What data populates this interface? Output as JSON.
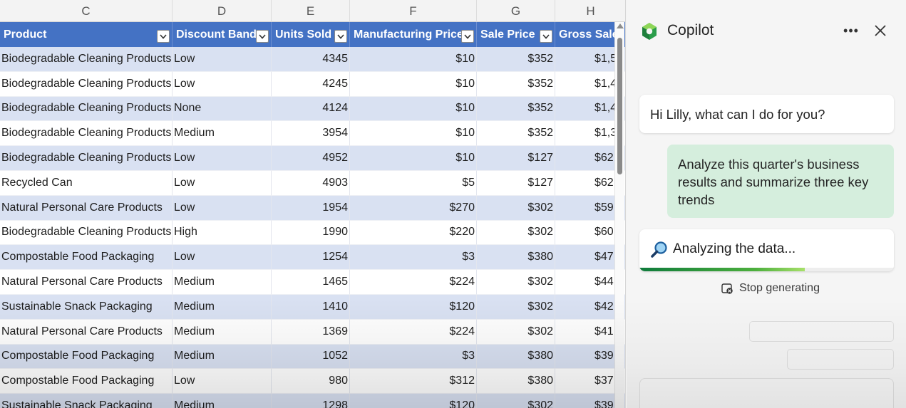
{
  "sheet": {
    "column_letters": [
      "C",
      "D",
      "E",
      "F",
      "G",
      "H"
    ],
    "headers": [
      "Product",
      "Discount Band",
      "Units Sold",
      "Manufacturing Price",
      "Sale Price",
      "Gross Sales"
    ],
    "rows": [
      [
        "Biodegradable Cleaning Products",
        "Low",
        "4345",
        "$10",
        "$352",
        "$1,5"
      ],
      [
        "Biodegradable Cleaning Products",
        "Low",
        "4245",
        "$10",
        "$352",
        "$1,4"
      ],
      [
        "Biodegradable Cleaning Products",
        "None",
        "4124",
        "$10",
        "$352",
        "$1,4"
      ],
      [
        "Biodegradable Cleaning Products",
        "Medium",
        "3954",
        "$10",
        "$352",
        "$1,3"
      ],
      [
        "Biodegradable Cleaning Products",
        "Low",
        "4952",
        "$10",
        "$127",
        "$62"
      ],
      [
        "Recycled Can",
        "Low",
        "4903",
        "$5",
        "$127",
        "$62"
      ],
      [
        "Natural Personal Care Products",
        "Low",
        "1954",
        "$270",
        "$302",
        "$59"
      ],
      [
        "Biodegradable Cleaning Products",
        "High",
        "1990",
        "$220",
        "$302",
        "$60"
      ],
      [
        "Compostable Food Packaging",
        "Low",
        "1254",
        "$3",
        "$380",
        "$47"
      ],
      [
        "Natural Personal Care Products",
        "Medium",
        "1465",
        "$224",
        "$302",
        "$44"
      ],
      [
        "Sustainable Snack Packaging",
        "Medium",
        "1410",
        "$120",
        "$302",
        "$42"
      ],
      [
        "Natural Personal Care Products",
        "Medium",
        "1369",
        "$224",
        "$302",
        "$41"
      ],
      [
        "Compostable Food Packaging",
        "Medium",
        "1052",
        "$3",
        "$380",
        "$39"
      ],
      [
        "Compostable Food Packaging",
        "Low",
        "980",
        "$312",
        "$380",
        "$37"
      ],
      [
        "Sustainable Snack Packaging",
        "Medium",
        "1298",
        "$120",
        "$302",
        "$39"
      ]
    ]
  },
  "copilot": {
    "title": "Copilot",
    "more_icon": "more-horizontal-icon",
    "close_icon": "close-icon",
    "greeting": "Hi Lilly, what can I do for you?",
    "user_message": "Analyze this quarter's business results and summarize three key trends",
    "status": "Analyzing the data...",
    "progress": 0.65,
    "stop_label": "Stop generating"
  },
  "colors": {
    "header_blue": "#4472c4",
    "band_blue": "#d9e1f2",
    "user_bubble": "#d5eedd",
    "progress_green": "#0f7b3c"
  }
}
